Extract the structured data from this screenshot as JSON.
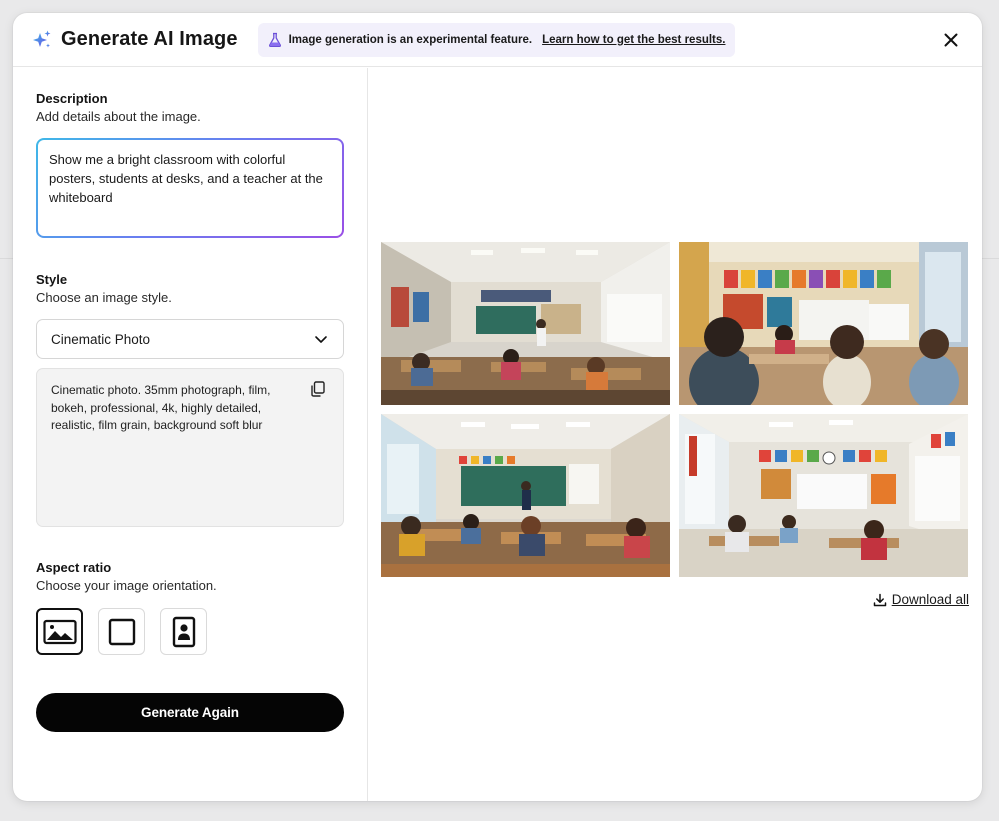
{
  "header": {
    "title": "Generate AI Image",
    "banner_text": "Image generation is an experimental feature.",
    "banner_link": "Learn how to get the best results."
  },
  "description": {
    "label": "Description",
    "hint": "Add details about the image.",
    "value": "Show me a bright classroom with colorful posters, students at desks, and a teacher at the whiteboard"
  },
  "style": {
    "label": "Style",
    "hint": "Choose an image style.",
    "selected": "Cinematic Photo",
    "style_prompt": "Cinematic photo. 35mm photograph, film, bokeh, professional, 4k, highly detailed, realistic, film grain, background soft blur"
  },
  "aspect_ratio": {
    "label": "Aspect ratio",
    "hint": "Choose your image orientation.",
    "options": [
      {
        "icon": "landscape-icon",
        "selected": true
      },
      {
        "icon": "square-icon",
        "selected": false
      },
      {
        "icon": "portrait-icon",
        "selected": false
      }
    ]
  },
  "actions": {
    "generate_label": "Generate Again",
    "download_label": "Download all"
  },
  "results": {
    "count": 4
  },
  "colors": {
    "accent_gradient_start": "#3fb8e8",
    "accent_gradient_end": "#9a4fe6",
    "banner_bg": "#f2f0fb",
    "primary_button": "#050505"
  }
}
